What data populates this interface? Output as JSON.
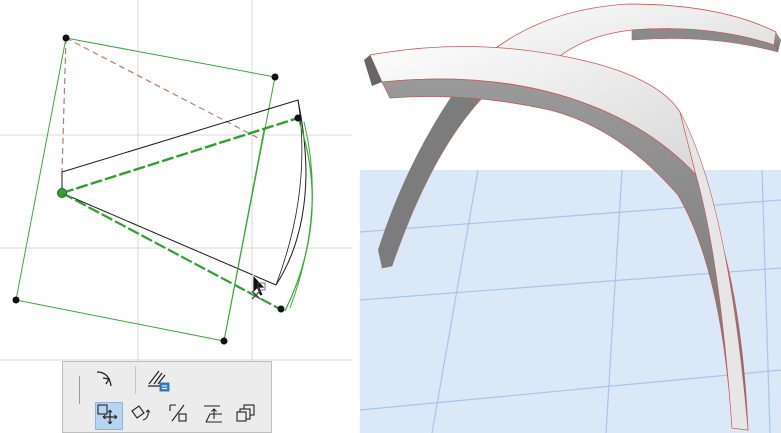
{
  "colors": {
    "background": "#ffffff",
    "grid": "#d9d9d9",
    "selection_green": "#2ea02e",
    "outline_black": "#1a1a1a",
    "dashed_brown": "#b47a7a",
    "palette_bg": "#ececec",
    "palette_active": "#b9d4f0",
    "floor_blue": "#dbe8f8",
    "floor_grid": "#a9c4ea",
    "shell_edge": "#c65a5a"
  },
  "palette": {
    "buttons": [
      {
        "name": "curve-arrow-tool",
        "icon": "curved-arrow-icon"
      },
      {
        "name": "reference-plane-tool",
        "icon": "layers-with-badge-icon"
      },
      {
        "name": "move-drag-tool",
        "icon": "move-cross-icon",
        "active": true
      },
      {
        "name": "rotate-tool",
        "icon": "rotate-icon"
      },
      {
        "name": "offset-tool",
        "icon": "percent-offset-icon"
      },
      {
        "name": "elevate-tool",
        "icon": "elevate-icon"
      },
      {
        "name": "multiply-tool",
        "icon": "copies-icon"
      }
    ]
  }
}
